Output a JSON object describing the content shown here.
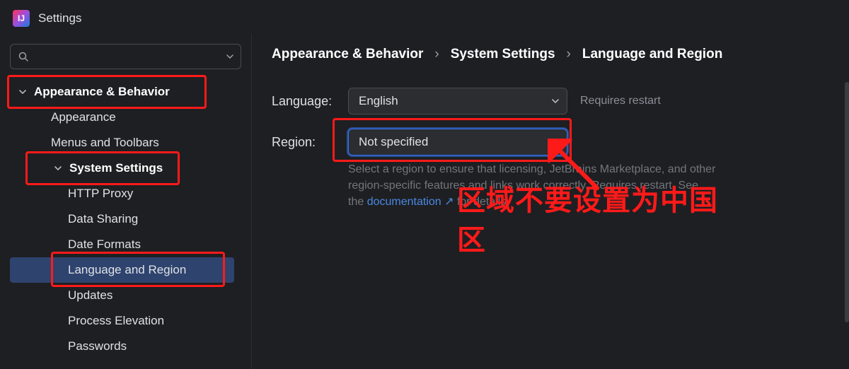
{
  "window": {
    "title": "Settings"
  },
  "search": {
    "placeholder": ""
  },
  "sidebar": {
    "items": [
      {
        "label": "Appearance & Behavior",
        "depth": 0,
        "bold": true,
        "expandable": true,
        "hi": true
      },
      {
        "label": "Appearance",
        "depth": 1
      },
      {
        "label": "Menus and Toolbars",
        "depth": 1
      },
      {
        "label": "System Settings",
        "depth": 1,
        "bold": true,
        "expandable": true,
        "hi": true
      },
      {
        "label": "HTTP Proxy",
        "depth": 2
      },
      {
        "label": "Data Sharing",
        "depth": 2
      },
      {
        "label": "Date Formats",
        "depth": 2
      },
      {
        "label": "Language and Region",
        "depth": 2,
        "selected": true,
        "hi": true
      },
      {
        "label": "Updates",
        "depth": 2
      },
      {
        "label": "Process Elevation",
        "depth": 2
      },
      {
        "label": "Passwords",
        "depth": 2
      }
    ]
  },
  "breadcrumbs": {
    "seg1": "Appearance & Behavior",
    "seg2": "System Settings",
    "seg3": "Language and Region",
    "sep": "›"
  },
  "fields": {
    "language_label": "Language:",
    "language_value": "English",
    "language_hint": "Requires restart",
    "region_label": "Region:",
    "region_value": "Not specified",
    "region_help_pre": "Select a region to ensure that licensing, JetBrains Marketplace, and other region-specific features and links work correctly. Requires restart. See the ",
    "region_help_link": "documentation ↗",
    "region_help_post": " for details."
  },
  "annotation": {
    "text_l1": "区域不要设置为中国",
    "text_l2": "区"
  }
}
